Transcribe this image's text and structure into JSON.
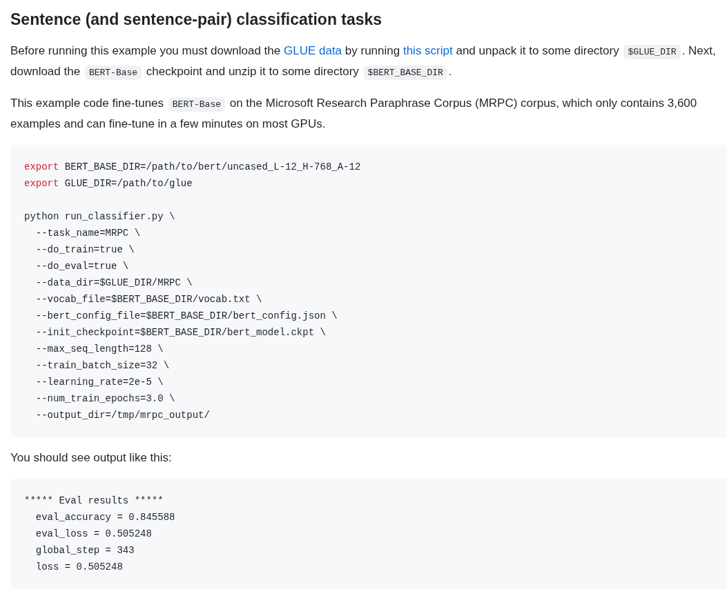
{
  "heading": "Sentence (and sentence-pair) classification tasks",
  "sections": [
    {
      "kind": "paragraph",
      "segments": [
        {
          "kind": "text",
          "text": "Before running this example you must download the "
        },
        {
          "kind": "link",
          "text": "GLUE data"
        },
        {
          "kind": "text",
          "text": " by running "
        },
        {
          "kind": "link",
          "text": "this script"
        },
        {
          "kind": "text",
          "text": " and unpack it to some directory "
        },
        {
          "kind": "code",
          "text": "$GLUE_DIR"
        },
        {
          "kind": "text",
          "text": ". Next, download the "
        },
        {
          "kind": "code",
          "text": "BERT-Base"
        },
        {
          "kind": "text",
          "text": " checkpoint and unzip it to some directory "
        },
        {
          "kind": "code",
          "text": "$BERT_BASE_DIR"
        },
        {
          "kind": "text",
          "text": "."
        }
      ]
    },
    {
      "kind": "paragraph",
      "segments": [
        {
          "kind": "text",
          "text": "This example code fine-tunes "
        },
        {
          "kind": "code",
          "text": "BERT-Base"
        },
        {
          "kind": "text",
          "text": " on the Microsoft Research Paraphrase Corpus (MRPC) corpus, which only contains 3,600 examples and can fine-tune in a few minutes on most GPUs."
        }
      ]
    },
    {
      "kind": "codeblock",
      "lines": [
        {
          "kind": "code",
          "segments": [
            {
              "kind": "keyword",
              "text": "export"
            },
            {
              "kind": "plain",
              "text": " BERT_BASE_DIR=/path/to/bert/uncased_L-12_H-768_A-12"
            }
          ]
        },
        {
          "kind": "code",
          "segments": [
            {
              "kind": "keyword",
              "text": "export"
            },
            {
              "kind": "plain",
              "text": " GLUE_DIR=/path/to/glue"
            }
          ]
        },
        {
          "kind": "blank"
        },
        {
          "kind": "code",
          "segments": [
            {
              "kind": "plain",
              "text": "python run_classifier.py \\"
            }
          ]
        },
        {
          "kind": "code",
          "segments": [
            {
              "kind": "plain",
              "text": "  --task_name=MRPC \\"
            }
          ]
        },
        {
          "kind": "code",
          "segments": [
            {
              "kind": "plain",
              "text": "  --do_train=true \\"
            }
          ]
        },
        {
          "kind": "code",
          "segments": [
            {
              "kind": "plain",
              "text": "  --do_eval=true \\"
            }
          ]
        },
        {
          "kind": "code",
          "segments": [
            {
              "kind": "plain",
              "text": "  --data_dir=$GLUE_DIR/MRPC \\"
            }
          ]
        },
        {
          "kind": "code",
          "segments": [
            {
              "kind": "plain",
              "text": "  --vocab_file=$BERT_BASE_DIR/vocab.txt \\"
            }
          ]
        },
        {
          "kind": "code",
          "segments": [
            {
              "kind": "plain",
              "text": "  --bert_config_file=$BERT_BASE_DIR/bert_config.json \\"
            }
          ]
        },
        {
          "kind": "code",
          "segments": [
            {
              "kind": "plain",
              "text": "  --init_checkpoint=$BERT_BASE_DIR/bert_model.ckpt \\"
            }
          ]
        },
        {
          "kind": "code",
          "segments": [
            {
              "kind": "plain",
              "text": "  --max_seq_length=128 \\"
            }
          ]
        },
        {
          "kind": "code",
          "segments": [
            {
              "kind": "plain",
              "text": "  --train_batch_size=32 \\"
            }
          ]
        },
        {
          "kind": "code",
          "segments": [
            {
              "kind": "plain",
              "text": "  --learning_rate=2e-5 \\"
            }
          ]
        },
        {
          "kind": "code",
          "segments": [
            {
              "kind": "plain",
              "text": "  --num_train_epochs=3.0 \\"
            }
          ]
        },
        {
          "kind": "code",
          "segments": [
            {
              "kind": "plain",
              "text": "  --output_dir=/tmp/mrpc_output/"
            }
          ]
        }
      ]
    },
    {
      "kind": "paragraph",
      "segments": [
        {
          "kind": "text",
          "text": "You should see output like this:"
        }
      ]
    },
    {
      "kind": "codeblock",
      "lines": [
        {
          "kind": "code",
          "segments": [
            {
              "kind": "plain",
              "text": "***** Eval results *****"
            }
          ]
        },
        {
          "kind": "code",
          "segments": [
            {
              "kind": "plain",
              "text": "  eval_accuracy = 0.845588"
            }
          ]
        },
        {
          "kind": "code",
          "segments": [
            {
              "kind": "plain",
              "text": "  eval_loss = 0.505248"
            }
          ]
        },
        {
          "kind": "code",
          "segments": [
            {
              "kind": "plain",
              "text": "  global_step = 343"
            }
          ]
        },
        {
          "kind": "code",
          "segments": [
            {
              "kind": "plain",
              "text": "  loss = 0.505248"
            }
          ]
        }
      ]
    }
  ]
}
